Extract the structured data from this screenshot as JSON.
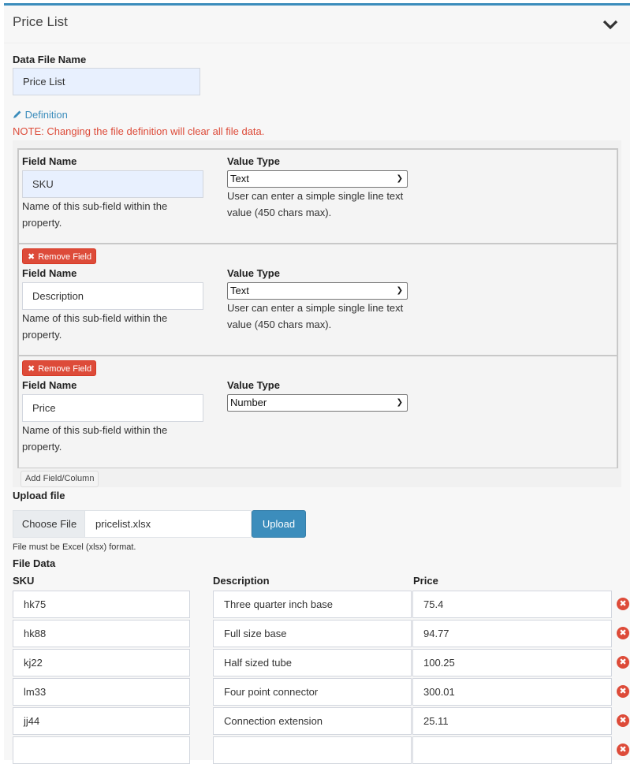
{
  "panel": {
    "title": "Price List",
    "collapse_icon": "chevron-down-icon"
  },
  "data_file_name": {
    "label": "Data File Name",
    "value": "Price List"
  },
  "definition": {
    "link_label": "Definition",
    "link_icon": "pencil-icon",
    "note": "NOTE: Changing the file definition will clear all file data."
  },
  "fields": [
    {
      "field_name_label": "Field Name",
      "field_name_value": "SKU",
      "field_name_help": [
        "Name of this sub-field within the",
        "property."
      ],
      "value_type_label": "Value Type",
      "value_type_selected": "Text",
      "value_type_help": [
        "User can enter a simple single line text",
        "value (450 chars max)."
      ],
      "removable": false
    },
    {
      "remove_label": "Remove Field",
      "field_name_label": "Field Name",
      "field_name_value": "Description",
      "field_name_help": [
        "Name of this sub-field within the",
        "property."
      ],
      "value_type_label": "Value Type",
      "value_type_selected": "Text",
      "value_type_help": [
        "User can enter a simple single line text",
        "value (450 chars max)."
      ],
      "removable": true
    },
    {
      "remove_label": "Remove Field",
      "field_name_label": "Field Name",
      "field_name_value": "Price",
      "field_name_help": [
        "Name of this sub-field within the",
        "property."
      ],
      "value_type_label": "Value Type",
      "value_type_selected": "Number",
      "value_type_help": [],
      "removable": true
    }
  ],
  "add_field_label": "Add Field/Column",
  "upload": {
    "label": "Upload file",
    "choose_label": "Choose File",
    "file_name": "pricelist.xlsx",
    "upload_label": "Upload",
    "note": "File must be Excel (xlsx) format."
  },
  "file_data": {
    "label": "File Data",
    "columns": [
      "SKU",
      "Description",
      "Price"
    ],
    "rows": [
      [
        "hk75",
        "Three quarter inch base",
        "75.4"
      ],
      [
        "hk88",
        "Full size base",
        "94.77"
      ],
      [
        "kj22",
        "Half sized tube",
        "100.25"
      ],
      [
        "lm33",
        "Four point connector",
        "300.01"
      ],
      [
        "jj44",
        "Connection extension",
        "25.11"
      ],
      [
        "",
        "",
        ""
      ]
    ],
    "delete_icon": "remove-circle-icon",
    "delete_glyph": "✖"
  },
  "colors": {
    "accent": "#3c8dbc",
    "danger": "#dd4b39",
    "panel_bg": "#f7f7f7"
  }
}
